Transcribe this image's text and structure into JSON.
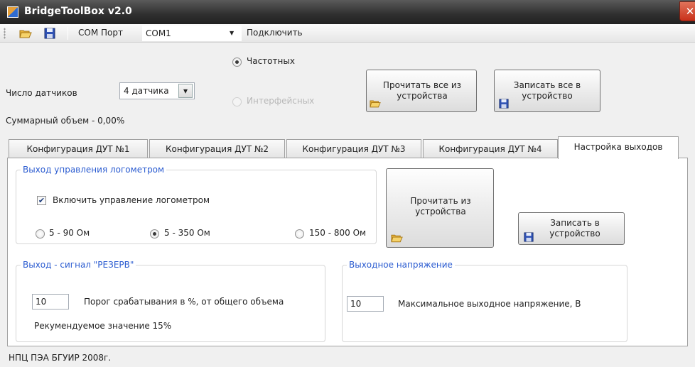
{
  "window": {
    "title": "BridgeToolBox v2.0",
    "close_glyph": "✕"
  },
  "toolbar": {
    "open_icon": "folder-open-icon",
    "save_icon": "floppy-disk-icon",
    "com_label": "COM Порт",
    "com_value": "COM1",
    "dropdown_glyph": "▼",
    "connect_label": "Подключить"
  },
  "sensors": {
    "count_label": "Число датчиков",
    "count_value": "4 датчика",
    "dropdown_glyph": "▾",
    "type_options": [
      {
        "label": "Частотных",
        "selected": true,
        "enabled": true
      },
      {
        "label": "Интерфейсных",
        "selected": false,
        "enabled": false
      }
    ],
    "total_volume": "Суммарный объем - 0,00%"
  },
  "top_buttons": {
    "read_all": "Прочитать все из устройства",
    "write_all": "Записать все в устройство"
  },
  "tabs": [
    {
      "label": "Конфигурация ДУТ №1",
      "active": false
    },
    {
      "label": "Конфигурация ДУТ №2",
      "active": false
    },
    {
      "label": "Конфигурация ДУТ №3",
      "active": false
    },
    {
      "label": "Конфигурация ДУТ №4",
      "active": false
    },
    {
      "label": "Настройка выходов",
      "active": true
    }
  ],
  "logometer": {
    "legend": "Выход управления логометром",
    "enable_label": "Включить управление логометром",
    "enable_checked": true,
    "check_glyph": "✔",
    "ranges": [
      {
        "label": "5 - 90 Ом",
        "selected": false
      },
      {
        "label": "5 - 350 Ом",
        "selected": true
      },
      {
        "label": "150 - 800 Ом",
        "selected": false
      }
    ]
  },
  "panel_buttons": {
    "read": "Прочитать из устройства",
    "write": "Записать в устройство"
  },
  "reserve": {
    "legend": "Выход - сигнал \"РЕЗЕРВ\"",
    "threshold_value": "10",
    "threshold_label": "Порог срабатывания в %, от общего объема",
    "recommended": "Рекумендуемое значение 15%"
  },
  "voltage": {
    "legend": "Выходное напряжение",
    "max_value": "10",
    "max_label": "Максимальное выходное напряжение, В"
  },
  "status": {
    "text": "НПЦ ПЭА БГУИР 2008г."
  }
}
